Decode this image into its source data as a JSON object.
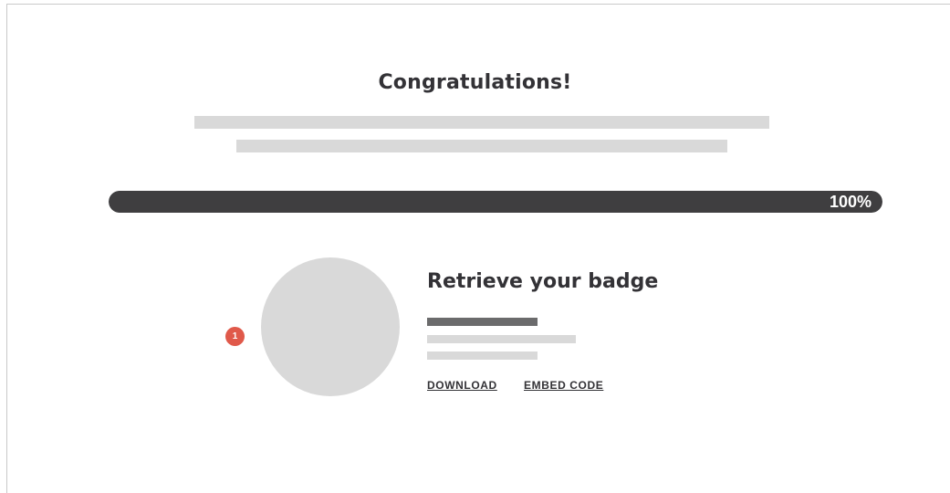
{
  "header": {
    "title": "Congratulations!"
  },
  "progress": {
    "value_percent": 100,
    "label": "100%"
  },
  "badge": {
    "step_number": "1",
    "heading": "Retrieve your badge",
    "download_label": "DOWNLOAD",
    "embed_label": "EMBED CODE"
  },
  "colors": {
    "text": "#333236",
    "progress_fill": "#3f3e40",
    "placeholder": "#d9d9d9",
    "marker": "#e0594a"
  }
}
